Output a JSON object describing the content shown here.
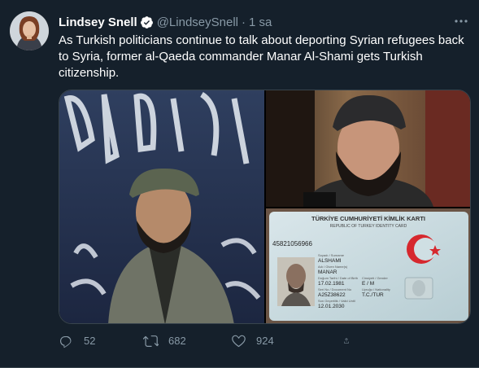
{
  "tweet": {
    "author": {
      "name": "Lindsey Snell",
      "handle": "@LindseySnell",
      "verified": true,
      "avatar_icon": "user-avatar"
    },
    "separator": "·",
    "time": "1 sa",
    "more_icon": "more-options-icon",
    "text": "As Turkish politicians continue to talk about deporting Syrian refugees back to Syria, former al-Qaeda commander Manar Al-Shami gets Turkish citizenship.",
    "media": {
      "id_card": {
        "title": "TÜRKİYE CUMHURİYETİ KİMLİK KARTI",
        "subtitle": "REPUBLIC OF TURKEY IDENTITY CARD",
        "id_number": "45821056966",
        "surname_label": "Soyadı / Surname",
        "surname": "ALSHAMI",
        "given_label": "Adı / Given Name(s)",
        "given": "MANAR",
        "dob_label": "Doğum Tarihi / Date of Birth",
        "dob": "17.02.1981",
        "gender_label": "Cinsiyeti / Gender",
        "gender": "E / M",
        "serial_label": "Seri No / Document No",
        "serial": "A25Z38622",
        "nationality_label": "Uyruğu / Nationality",
        "nationality": "T.C./TUR",
        "expiry_label": "Son Geçerlilik / Valid Until",
        "expiry": "12.01.2030"
      }
    },
    "actions": {
      "reply": "52",
      "retweet": "682",
      "like": "924"
    },
    "colors": {
      "background": "#15202b",
      "secondary_text": "#8899a6",
      "verified_blue": "#1da1f2"
    }
  }
}
